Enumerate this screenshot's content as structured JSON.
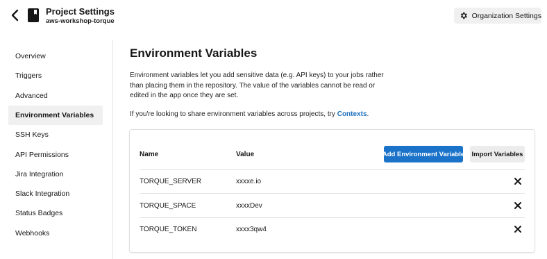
{
  "header": {
    "project_title": "Project Settings",
    "project_name": "aws-workshop-torque",
    "org_button_label": "Organization Settings",
    "back_icon": "chevron-left-icon",
    "project_icon": "book-icon",
    "org_icon": "gear-icon"
  },
  "sidebar": {
    "items": [
      {
        "label": "Overview",
        "active": false
      },
      {
        "label": "Triggers",
        "active": false
      },
      {
        "label": "Advanced",
        "active": false
      },
      {
        "label": "Environment Variables",
        "active": true
      },
      {
        "label": "SSH Keys",
        "active": false
      },
      {
        "label": "API Permissions",
        "active": false
      },
      {
        "label": "Jira Integration",
        "active": false
      },
      {
        "label": "Slack Integration",
        "active": false
      },
      {
        "label": "Status Badges",
        "active": false
      },
      {
        "label": "Webhooks",
        "active": false
      }
    ]
  },
  "main": {
    "title": "Environment Variables",
    "description": "Environment variables let you add sensitive data (e.g. API keys) to your jobs rather than placing them in the repository. The value of the variables cannot be read or edited in the app once they are set.",
    "share_text": "If you're looking to share environment variables across projects, try ",
    "share_link": "Contexts",
    "share_suffix": "."
  },
  "table": {
    "headers": {
      "name": "Name",
      "value": "Value"
    },
    "add_button": "Add Environment Variable",
    "import_button": "Import Variables",
    "rows": [
      {
        "name": "TORQUE_SERVER",
        "value": "xxxxe.io"
      },
      {
        "name": "TORQUE_SPACE",
        "value": "xxxxDev"
      },
      {
        "name": "TORQUE_TOKEN",
        "value": "xxxx3qw4"
      }
    ],
    "delete_icon": "close-icon"
  },
  "colors": {
    "accent": "#1a73c9",
    "link": "#1d6fbf",
    "active_nav_bg": "#f0f0f0",
    "border": "#e3e3e3"
  }
}
